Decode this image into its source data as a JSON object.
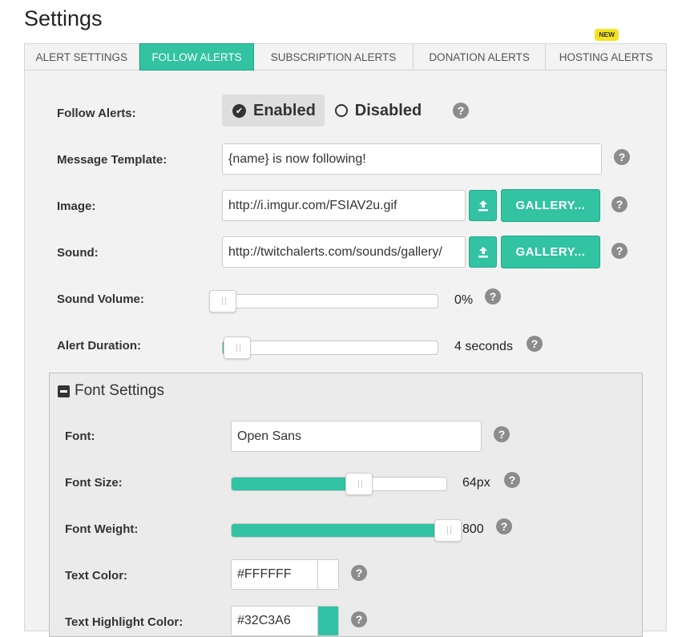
{
  "page": {
    "title": "Settings"
  },
  "tabs": [
    {
      "label": "ALERT SETTINGS",
      "active": false
    },
    {
      "label": "FOLLOW ALERTS",
      "active": true
    },
    {
      "label": "SUBSCRIPTION ALERTS",
      "active": false
    },
    {
      "label": "DONATION ALERTS",
      "active": false
    },
    {
      "label": "HOSTING ALERTS",
      "active": false,
      "badge": "NEW"
    }
  ],
  "follow_alerts": {
    "label": "Follow Alerts:",
    "options": [
      "Enabled",
      "Disabled"
    ],
    "selected": "Enabled"
  },
  "message_template": {
    "label": "Message Template:",
    "value": "{name} is now following!"
  },
  "image": {
    "label": "Image:",
    "value": "http://i.imgur.com/FSIAV2u.gif",
    "gallery_label": "GALLERY..."
  },
  "sound": {
    "label": "Sound:",
    "value": "http://twitchalerts.com/sounds/gallery/",
    "gallery_label": "GALLERY..."
  },
  "sound_volume": {
    "label": "Sound Volume:",
    "value": 0,
    "display": "0%"
  },
  "alert_duration": {
    "label": "Alert Duration:",
    "value": 4,
    "max": 60,
    "display": "4 seconds"
  },
  "font_settings": {
    "header": "Font Settings",
    "font": {
      "label": "Font:",
      "value": "Open Sans"
    },
    "font_size": {
      "label": "Font Size:",
      "value": 64,
      "fraction": 0.59,
      "display": "64px"
    },
    "font_weight": {
      "label": "Font Weight:",
      "value": 800,
      "fraction": 1.0,
      "display": "800"
    },
    "text_color": {
      "label": "Text Color:",
      "value": "#FFFFFF",
      "swatch": "#FFFFFF"
    },
    "text_highlight_color": {
      "label": "Text Highlight Color:",
      "value": "#32C3A6",
      "swatch": "#32C3A6"
    }
  },
  "colors": {
    "accent": "#31c3a2",
    "help_icon": "#8c8c8c"
  },
  "icons": {
    "help": "?",
    "upload": "upload-icon",
    "check": "check-icon",
    "collapse": "minus-square-icon"
  }
}
